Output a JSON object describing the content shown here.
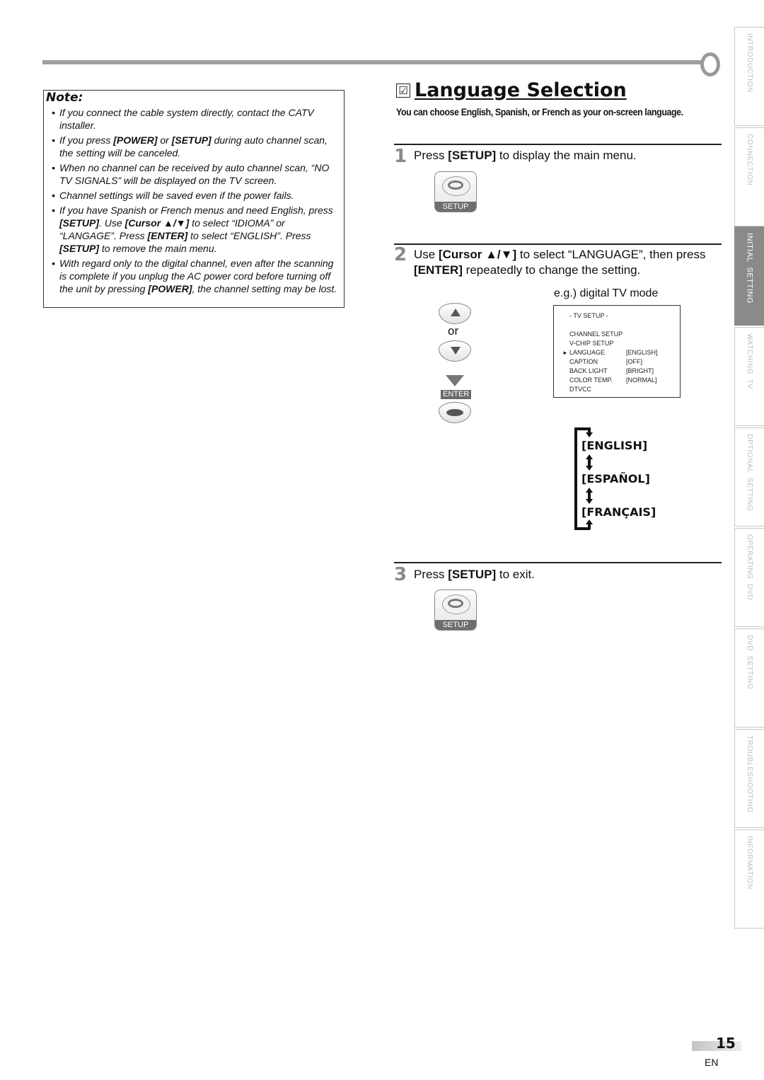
{
  "note": {
    "title": "Note:",
    "items": [
      {
        "parts": [
          {
            "t": "If you connect the cable system directly, contact the CATV installer.",
            "b": false
          }
        ]
      },
      {
        "parts": [
          {
            "t": "If you press ",
            "b": false
          },
          {
            "t": "[POWER]",
            "b": true
          },
          {
            "t": " or ",
            "b": false
          },
          {
            "t": "[SETUP]",
            "b": true
          },
          {
            "t": " during auto channel scan, the setting will be canceled.",
            "b": false
          }
        ]
      },
      {
        "parts": [
          {
            "t": "When no channel can be received by auto channel scan, “NO TV SIGNALS” will be displayed on the TV screen.",
            "b": false
          }
        ]
      },
      {
        "parts": [
          {
            "t": "Channel settings will be saved even if the power fails.",
            "b": false
          }
        ]
      },
      {
        "parts": [
          {
            "t": "If you have Spanish or French menus and need English, press ",
            "b": false
          },
          {
            "t": "[SETUP]",
            "b": true
          },
          {
            "t": ". Use ",
            "b": false
          },
          {
            "t": "[Cursor ▲/▼]",
            "b": true
          },
          {
            "t": " to select “IDIOMA” or “LANGAGE”. Press ",
            "b": false
          },
          {
            "t": "[ENTER]",
            "b": true
          },
          {
            "t": " to select “ENGLISH”. Press ",
            "b": false
          },
          {
            "t": "[SETUP]",
            "b": true
          },
          {
            "t": " to remove the main menu.",
            "b": false
          }
        ]
      },
      {
        "parts": [
          {
            "t": "With regard only to the digital channel, even after the scanning is complete if you unplug the AC power cord before turning off the unit by pressing ",
            "b": false
          },
          {
            "t": "[POWER]",
            "b": true
          },
          {
            "t": ", the channel setting may be lost.",
            "b": false
          }
        ]
      }
    ]
  },
  "section": {
    "check_icon": "☑",
    "title": "Language Selection",
    "subtitle": "You can choose English, Spanish, or French as your on-screen language."
  },
  "steps": [
    {
      "num": "1",
      "parts": [
        {
          "t": "Press ",
          "b": false
        },
        {
          "t": "[SETUP]",
          "b": true
        },
        {
          "t": " to display the main menu.",
          "b": false
        }
      ]
    },
    {
      "num": "2",
      "parts": [
        {
          "t": "Use ",
          "b": false
        },
        {
          "t": "[Cursor ▲/▼]",
          "b": true
        },
        {
          "t": " to select “LANGUAGE”, then press ",
          "b": false
        },
        {
          "t": "[ENTER]",
          "b": true
        },
        {
          "t": " repeatedly to change the setting.",
          "b": false
        }
      ]
    },
    {
      "num": "3",
      "parts": [
        {
          "t": "Press ",
          "b": false
        },
        {
          "t": "[SETUP]",
          "b": true
        },
        {
          "t": " to exit.",
          "b": false
        }
      ]
    }
  ],
  "buttons": {
    "setup_label": "SETUP",
    "or_label": "or",
    "enter_label": "ENTER"
  },
  "tv_menu": {
    "caption": "e.g.) digital TV mode",
    "title": "-   TV SETUP   -",
    "rows": [
      {
        "label": "CHANNEL SETUP",
        "value": "",
        "selected": false
      },
      {
        "label": "V-CHIP  SETUP",
        "value": "",
        "selected": false
      },
      {
        "label": "LANGUAGE",
        "value": "[ENGLISH]",
        "selected": true
      },
      {
        "label": "CAPTION",
        "value": "[OFF]",
        "selected": false
      },
      {
        "label": "BACK  LIGHT",
        "value": "[BRIGHT]",
        "selected": false
      },
      {
        "label": "COLOR  TEMP.",
        "value": "[NORMAL]",
        "selected": false
      },
      {
        "label": "DTVCC",
        "value": "",
        "selected": false
      }
    ],
    "pointer": "►"
  },
  "language_cycle": [
    "[ENGLISH]",
    "[ESPAÑOL]",
    "[FRANÇAIS]"
  ],
  "side_tabs": [
    {
      "label": "INTRODUCTION",
      "active": false
    },
    {
      "label": "CONNECTION",
      "active": false
    },
    {
      "label": "INITIAL  SETTING",
      "active": true
    },
    {
      "label": "WATCHING  TV",
      "active": false
    },
    {
      "label": "OPTIONAL  SETTING",
      "active": false
    },
    {
      "label": "OPERATING  DVD",
      "active": false
    },
    {
      "label": "DVD  SETTING",
      "active": false
    },
    {
      "label": "TROUBLESHOOTING",
      "active": false
    },
    {
      "label": "INFORMATION",
      "active": false
    }
  ],
  "footer": {
    "page_number": "15",
    "language": "EN"
  }
}
